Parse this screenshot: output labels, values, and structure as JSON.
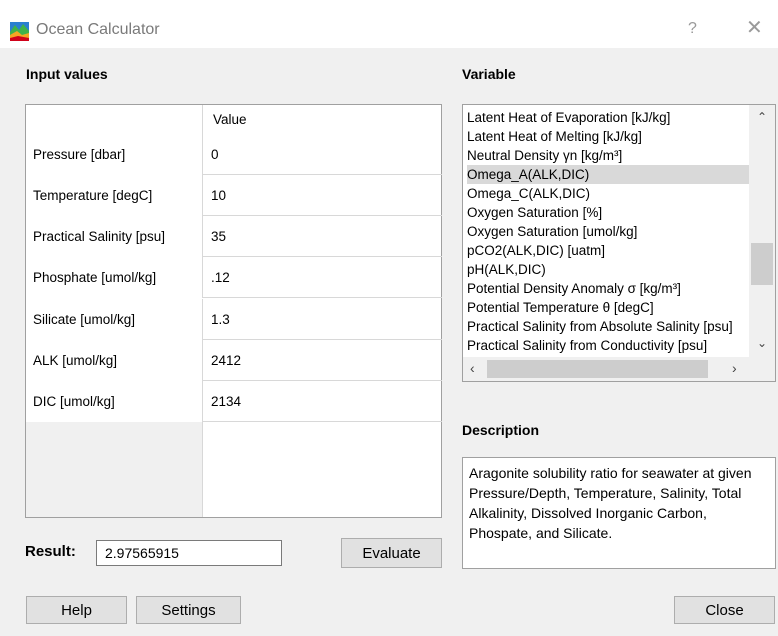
{
  "window": {
    "title": "Ocean Calculator",
    "help_glyph": "?",
    "close_glyph": "✕",
    "icon": "ocean-app-icon"
  },
  "inputs": {
    "heading": "Input values",
    "column_header": "Value",
    "rows": [
      {
        "label": "Pressure [dbar]",
        "value": "0"
      },
      {
        "label": "Temperature [degC]",
        "value": "10"
      },
      {
        "label": "Practical Salinity [psu]",
        "value": "35"
      },
      {
        "label": "Phosphate [umol/kg]",
        "value": ".12"
      },
      {
        "label": "Silicate [umol/kg]",
        "value": "1.3"
      },
      {
        "label": "ALK [umol/kg]",
        "value": "2412"
      },
      {
        "label": "DIC [umol/kg]",
        "value": "2134"
      }
    ]
  },
  "result": {
    "label": "Result:",
    "value": "2.97565915",
    "evaluate_label": "Evaluate"
  },
  "variable": {
    "heading": "Variable",
    "selected": "Omega_A(ALK,DIC)",
    "items": [
      "Latent Heat of Evaporation [kJ/kg]",
      "Latent Heat of Melting [kJ/kg]",
      "Neutral Density γn [kg/m³]",
      "Omega_A(ALK,DIC)",
      "Omega_C(ALK,DIC)",
      "Oxygen Saturation [%]",
      "Oxygen Saturation [umol/kg]",
      "pCO2(ALK,DIC) [uatm]",
      "pH(ALK,DIC)",
      "Potential Density Anomaly σ [kg/m³]",
      "Potential Temperature θ [degC]",
      "Practical Salinity from Absolute Salinity [psu]",
      "Practical Salinity from Conductivity [psu]"
    ]
  },
  "description": {
    "heading": "Description",
    "text": "Aragonite solubility ratio for seawater at given Pressure/Depth, Temperature, Salinity, Total Alkalinity, Dissolved Inorganic Carbon, Phospate, and Silicate."
  },
  "footer": {
    "help_label": "Help",
    "settings_label": "Settings",
    "close_label": "Close"
  },
  "colors": {
    "selection": "#d9d9d9",
    "button": "#e1e1e1",
    "background": "#f0f0f0"
  }
}
